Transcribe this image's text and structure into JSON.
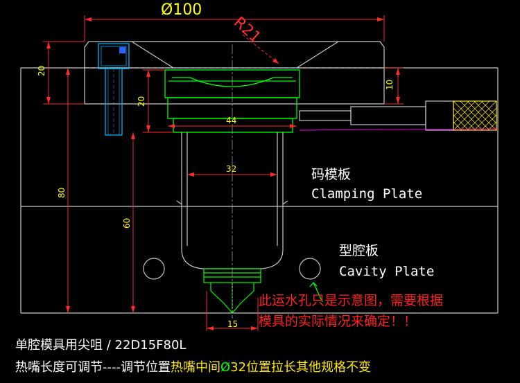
{
  "dimensions": {
    "dia100": "Ø100",
    "r21": "R21",
    "d20_left": "20",
    "d20_inner": "20",
    "d10": "10",
    "d44": "44",
    "d32": "32",
    "d80": "80",
    "d60": "60",
    "d15": "15"
  },
  "labels": {
    "clamping_cn": "码模板",
    "clamping_en": "Clamping Plate",
    "cavity_cn": "型腔板",
    "cavity_en": "Cavity Plate"
  },
  "note": {
    "line1": "此运水孔只是示意图，需要根据",
    "line2": "模具的实际情况来确定！！"
  },
  "caption": {
    "line1": "单腔模具用尖咀 / 22D15F80L",
    "line2_prefix": "热嘴长度可调节----调节位置",
    "line2_mid": "热嘴中间",
    "line2_phi": "Ø",
    "line2_size": "32",
    "line2_suffix": "位置拉长其他规格不变"
  },
  "colors": {
    "background": "#000000",
    "outline": "#c8c8c8",
    "nozzle": "#00ff00",
    "dimension": "#ff2a2a",
    "dim_text": "#ffff00",
    "note": "#ff2020",
    "screw": "#00b4ff",
    "heater": "#ffe800",
    "leader": "#ff00ff"
  }
}
